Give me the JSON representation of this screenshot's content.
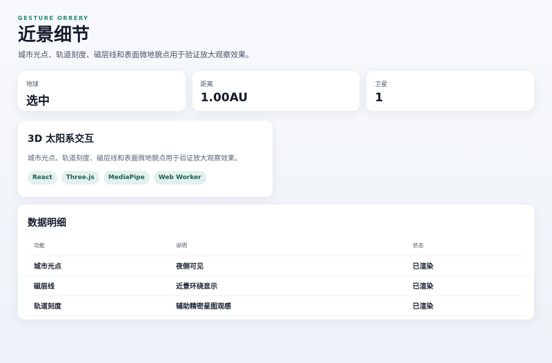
{
  "header": {
    "eyebrow": "GESTURE ORRERY",
    "title": "近景细节",
    "subtitle": "城市光点、轨道刻度、磁层线和表面微地貌点用于验证放大观察效果。"
  },
  "stats": [
    {
      "label": "地球",
      "value": "选中"
    },
    {
      "label": "距离",
      "value": "1.00AU"
    },
    {
      "label": "卫星",
      "value": "1"
    }
  ],
  "feature": {
    "title": "3D 太阳系交互",
    "description": "城市光点、轨道刻度、磁层线和表面微地貌点用于验证放大观察效果。",
    "tags": [
      "React",
      "Three.js",
      "MediaPipe",
      "Web Worker"
    ]
  },
  "table": {
    "title": "数据明细",
    "columns": [
      "功能",
      "说明",
      "状态"
    ],
    "rows": [
      [
        "城市光点",
        "夜侧可见",
        "已渲染"
      ],
      [
        "磁层线",
        "近景环绕显示",
        "已渲染"
      ],
      [
        "轨道刻度",
        "辅助精密星图观感",
        "已渲染"
      ]
    ]
  },
  "colors": {
    "accent": "#1f8a70",
    "tag_bg": "#e3f1ee",
    "background": "#f3f6fa"
  }
}
